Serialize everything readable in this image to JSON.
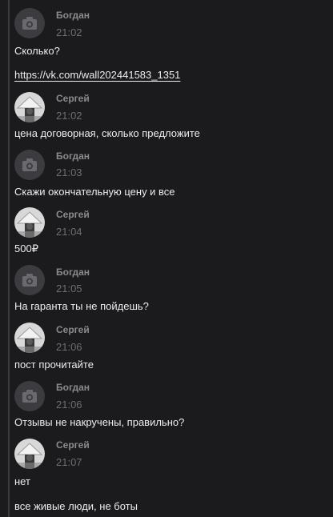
{
  "messages": [
    {
      "author": "Богдан",
      "avatar": "camera-placeholder-icon",
      "time": "21:02",
      "lines": [
        "Сколько?"
      ],
      "link": "https://vk.com/wall202441583_1351"
    },
    {
      "author": "Сергей",
      "avatar": "user-photo",
      "time": "21:02",
      "lines": [
        "цена договорная, сколько предложите"
      ]
    },
    {
      "author": "Богдан",
      "avatar": "camera-placeholder-icon",
      "time": "21:03",
      "lines": [
        "Скажи окончательную цену и все"
      ]
    },
    {
      "author": "Сергей",
      "avatar": "user-photo",
      "time": "21:04",
      "lines": [
        "500₽"
      ]
    },
    {
      "author": "Богдан",
      "avatar": "camera-placeholder-icon",
      "time": "21:05",
      "lines": [
        "На гаранта ты не пойдешь?"
      ]
    },
    {
      "author": "Сергей",
      "avatar": "user-photo",
      "time": "21:06",
      "lines": [
        "пост прочитайте"
      ]
    },
    {
      "author": "Богдан",
      "avatar": "camera-placeholder-icon",
      "time": "21:06",
      "lines": [
        "Отзывы не накручены, правильно?"
      ]
    },
    {
      "author": "Сергей",
      "avatar": "user-photo",
      "time": "21:07",
      "lines": [
        "нет",
        "все живые люди, не боты"
      ]
    }
  ]
}
